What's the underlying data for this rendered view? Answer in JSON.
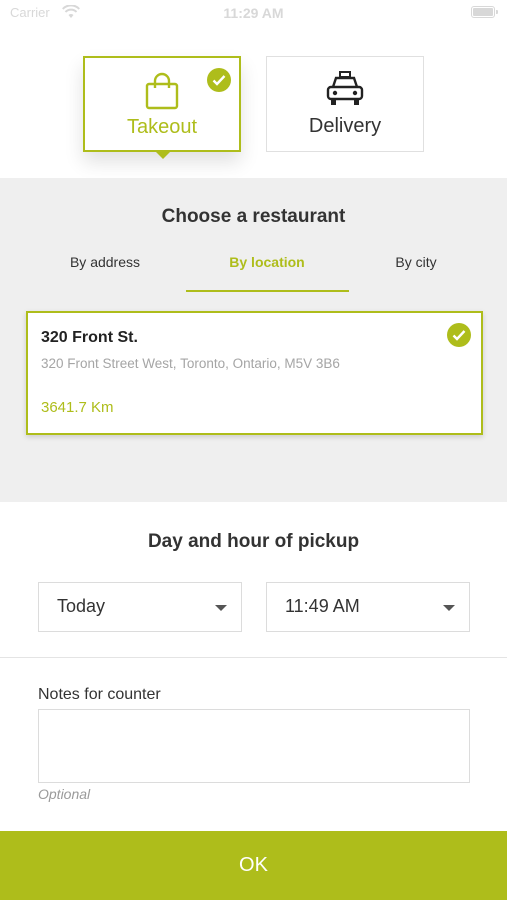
{
  "status_bar": {
    "carrier": "Carrier",
    "time": "11:29 AM"
  },
  "order_type": {
    "options": [
      {
        "label": "Takeout",
        "selected": true,
        "icon": "shopping-bag-icon"
      },
      {
        "label": "Delivery",
        "selected": false,
        "icon": "taxi-icon"
      }
    ]
  },
  "restaurant": {
    "title": "Choose a restaurant",
    "tabs": [
      {
        "label": "By address",
        "active": false
      },
      {
        "label": "By location",
        "active": true
      },
      {
        "label": "By city",
        "active": false
      }
    ],
    "selected": {
      "name": "320 Front St.",
      "address": "320 Front Street West, Toronto, Ontario, M5V 3B6",
      "distance": "3641.7 Km"
    }
  },
  "pickup": {
    "title": "Day and hour of pickup",
    "day": "Today",
    "hour": "11:49 AM"
  },
  "notes": {
    "label": "Notes for counter",
    "value": "",
    "hint": "Optional"
  },
  "actions": {
    "ok_label": "OK"
  },
  "colors": {
    "accent": "#aebd1b",
    "section_bg": "#efefef"
  }
}
